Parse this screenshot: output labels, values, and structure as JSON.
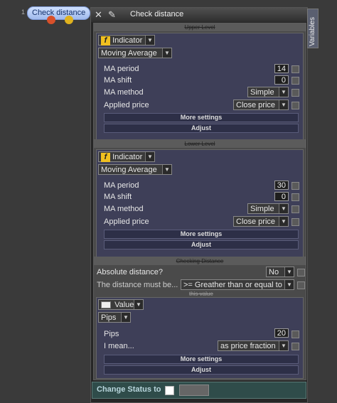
{
  "node": {
    "number": "1",
    "label": "Check distance"
  },
  "window": {
    "title": "Check distance",
    "side_tab": "Variables"
  },
  "upper": {
    "header": "Upper Level",
    "indicator_label": "Indicator",
    "indicator_type": "Moving Average",
    "params": [
      {
        "label": "MA period",
        "value": "14"
      },
      {
        "label": "MA shift",
        "value": "0"
      },
      {
        "label": "MA method",
        "value": "Simple"
      },
      {
        "label": "Applied price",
        "value": "Close price"
      }
    ],
    "more": "More settings",
    "adjust": "Adjust"
  },
  "lower": {
    "header": "Lower Level",
    "indicator_label": "Indicator",
    "indicator_type": "Moving Average",
    "params": [
      {
        "label": "MA period",
        "value": "30"
      },
      {
        "label": "MA shift",
        "value": "0"
      },
      {
        "label": "MA method",
        "value": "Simple"
      },
      {
        "label": "Applied price",
        "value": "Close price"
      }
    ],
    "more": "More settings",
    "adjust": "Adjust"
  },
  "checking": {
    "header": "Checking Distance",
    "absolute_label": "Absolute distance?",
    "absolute_value": "No",
    "distance_label": "The distance must be...",
    "distance_value": ">= Greather than or equal to",
    "this_value": "this value",
    "value_label": "Value",
    "units": "Pips",
    "pips_label": "Pips",
    "pips_value": "20",
    "mean_label": "I mean...",
    "mean_value": "as price fraction",
    "more": "More settings",
    "adjust": "Adjust"
  },
  "status": {
    "label": "Change Status to"
  }
}
